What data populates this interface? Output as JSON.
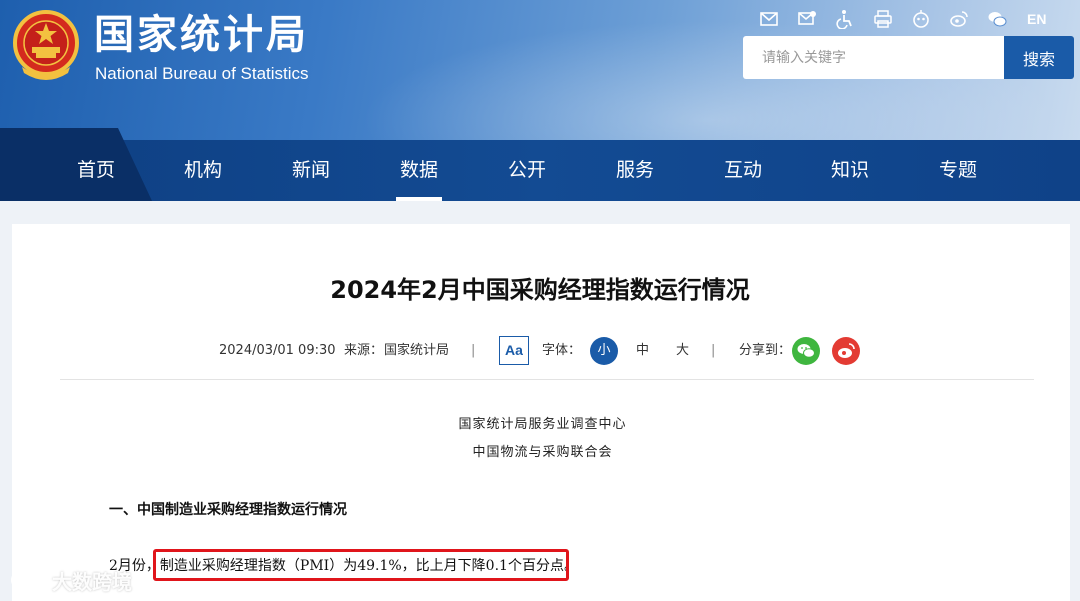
{
  "header": {
    "site_name_cn": "国家统计局",
    "site_name_en": "National Bureau of Statistics",
    "lang_switch": "EN",
    "top_icons": [
      "mail-icon",
      "mail-subscribe-icon",
      "accessibility-icon",
      "print-icon",
      "robot-icon",
      "weibo-icon",
      "wechat-icon"
    ],
    "search": {
      "placeholder": "请输入关键字",
      "button_label": "搜索"
    }
  },
  "nav": {
    "items": [
      {
        "label": "首页"
      },
      {
        "label": "机构"
      },
      {
        "label": "新闻"
      },
      {
        "label": "数据"
      },
      {
        "label": "公开"
      },
      {
        "label": "服务"
      },
      {
        "label": "互动"
      },
      {
        "label": "知识"
      },
      {
        "label": "专题"
      }
    ],
    "active": "数据"
  },
  "article": {
    "title": "2024年2月中国采购经理指数运行情况",
    "datetime": "2024/03/01 09:30",
    "source_label": "来源：",
    "source": "国家统计局",
    "separator": "|",
    "aa_label": "Aa",
    "font_label": "字体：",
    "font_sizes": [
      "小",
      "中",
      "大"
    ],
    "share_label": "分享到：",
    "org_lines": [
      "国家统计局服务业调查中心",
      "中国物流与采购联合会"
    ],
    "section_heading": "一、中国制造业采购经理指数运行情况",
    "para_prefix": "2月份，",
    "para_highlight": "制造业采购经理指数（PMI）为49.1%，比上月下降0.1个百分点。"
  },
  "watermark": {
    "text": "大数跨境"
  },
  "colors": {
    "brand_blue": "#1a5ba8",
    "nav_blue": "#134b93",
    "highlight_red": "#e0151b",
    "wechat_green": "#3fb63f",
    "weibo_red": "#e33b33"
  }
}
